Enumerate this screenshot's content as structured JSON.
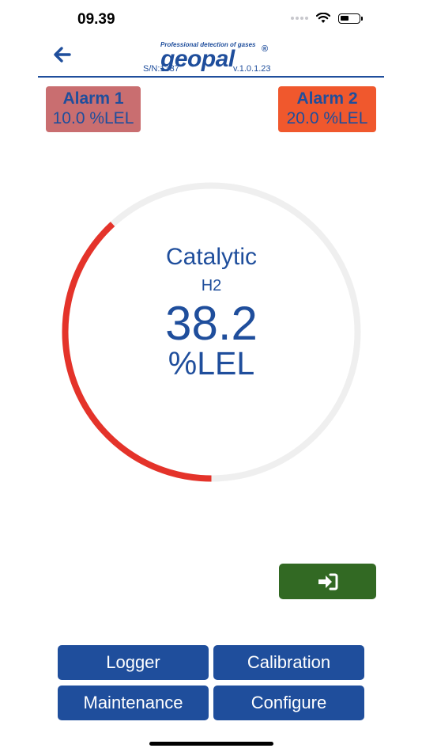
{
  "status_bar": {
    "time": "09.39"
  },
  "header": {
    "brand_tagline": "Professional detection of gases",
    "brand_name": "geopal",
    "brand_reg": "®",
    "serial": "S/N:1337",
    "version": "v.1.0.1.23"
  },
  "alarms": [
    {
      "label": "Alarm 1",
      "value": "10.0 %LEL",
      "color": "#c96e70"
    },
    {
      "label": "Alarm 2",
      "value": "20.0 %LEL",
      "color": "#f0582d"
    }
  ],
  "gauge": {
    "sensor_type": "Catalytic",
    "gas": "H2",
    "reading": "38.2",
    "unit": "%LEL",
    "fraction": 0.382,
    "arc_color": "#e4332a",
    "track_color": "#efefef"
  },
  "buttons": {
    "logger": "Logger",
    "calibration": "Calibration",
    "maintenance": "Maintenance",
    "configure": "Configure"
  },
  "icons": {
    "back": "arrow-left-icon",
    "login": "sign-in-icon",
    "wifi": "wifi-icon",
    "battery": "battery-icon"
  }
}
